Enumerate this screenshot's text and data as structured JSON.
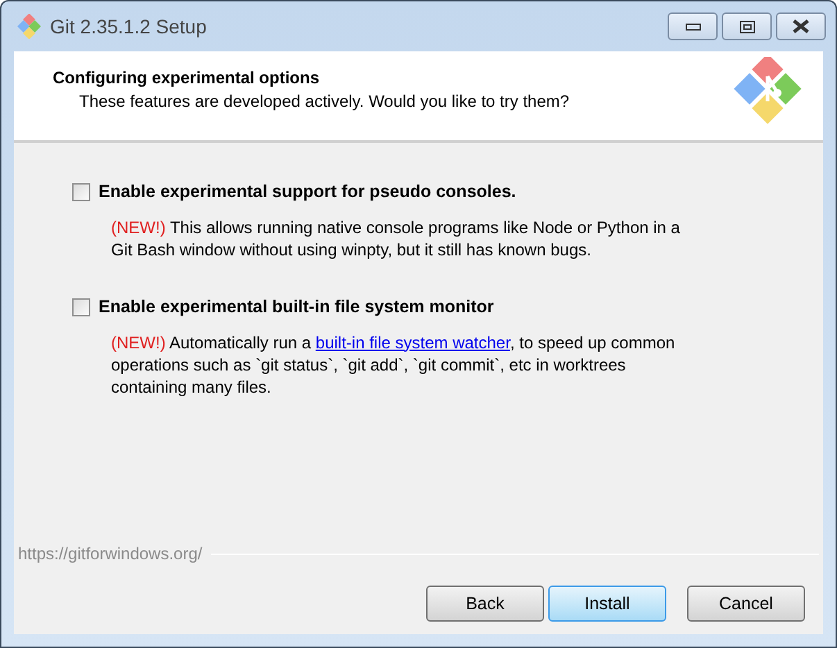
{
  "window": {
    "title": "Git 2.35.1.2 Setup"
  },
  "header": {
    "title": "Configuring experimental options",
    "subtitle": "These features are developed actively. Would you like to try them?"
  },
  "options": [
    {
      "label": "Enable experimental support for pseudo consoles.",
      "checked": false,
      "description": [
        {
          "kind": "tag",
          "text": "(NEW!)"
        },
        {
          "kind": "text",
          "text": " This allows running native console programs like Node or Python in a Git Bash window without using winpty, but it still has known bugs."
        }
      ]
    },
    {
      "label": "Enable experimental built-in file system monitor",
      "checked": false,
      "description": [
        {
          "kind": "tag",
          "text": "(NEW!)"
        },
        {
          "kind": "text",
          "text": " Automatically run a "
        },
        {
          "kind": "link",
          "text": "built-in file system watcher"
        },
        {
          "kind": "text",
          "text": ", to speed up common operations such as `git status`, `git add`, `git commit`, etc in worktrees containing many files."
        }
      ]
    }
  ],
  "footer_url": "https://gitforwindows.org/",
  "buttons": [
    {
      "label": "Back",
      "default": false
    },
    {
      "label": "Install",
      "default": true
    },
    {
      "label": "Cancel",
      "default": false
    }
  ]
}
